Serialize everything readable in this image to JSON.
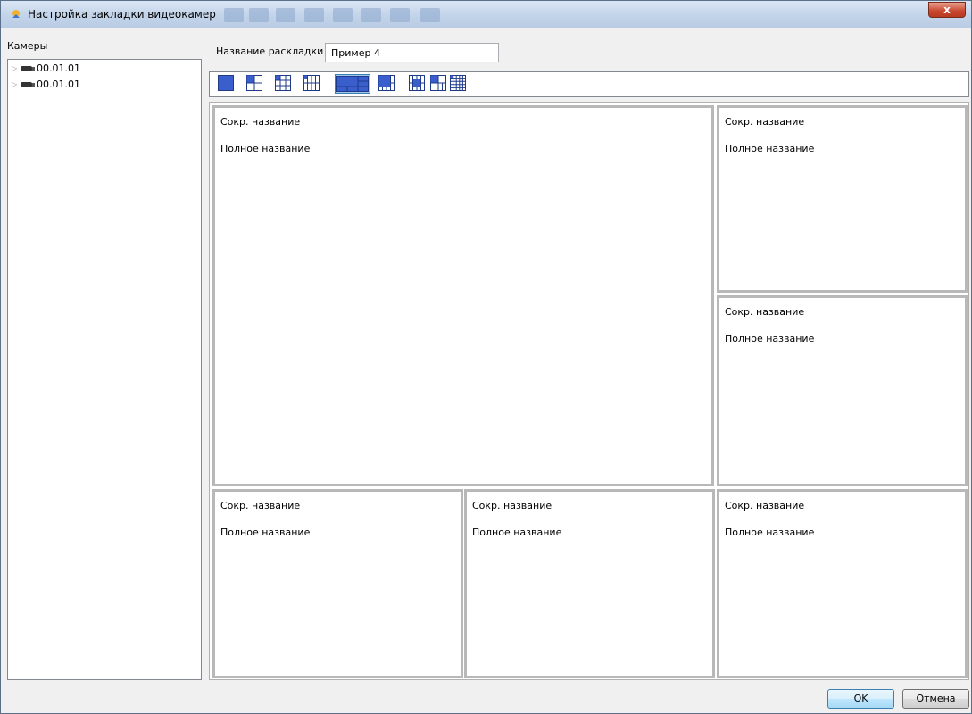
{
  "window": {
    "title": "Настройка закладки видеокамер",
    "close_label": "x"
  },
  "left_panel": {
    "label": "Камеры",
    "tree_items": [
      {
        "label": "00.01.01"
      },
      {
        "label": "00.01.01"
      }
    ]
  },
  "layout_name": {
    "label": "Название раскладки",
    "value": "Пример 4"
  },
  "toolbar": {
    "selected_index": 4,
    "layouts": [
      "1x1",
      "2x2-large",
      "3x3",
      "4x4",
      "1+5",
      "1+7",
      "1+12",
      "3x3-alt",
      "5x5"
    ]
  },
  "cells": [
    {
      "short": "Сокр. название",
      "full": "Полное название"
    },
    {
      "short": "Сокр. название",
      "full": "Полное название"
    },
    {
      "short": "Сокр. название",
      "full": "Полное название"
    },
    {
      "short": "Сокр. название",
      "full": "Полное название"
    },
    {
      "short": "Сокр. название",
      "full": "Полное название"
    },
    {
      "short": "Сокр. название",
      "full": "Полное название"
    }
  ],
  "buttons": {
    "ok": "OK",
    "cancel": "Отмена"
  },
  "colors": {
    "accent": "#3a5fcd",
    "selected": "#9fc6ee"
  }
}
